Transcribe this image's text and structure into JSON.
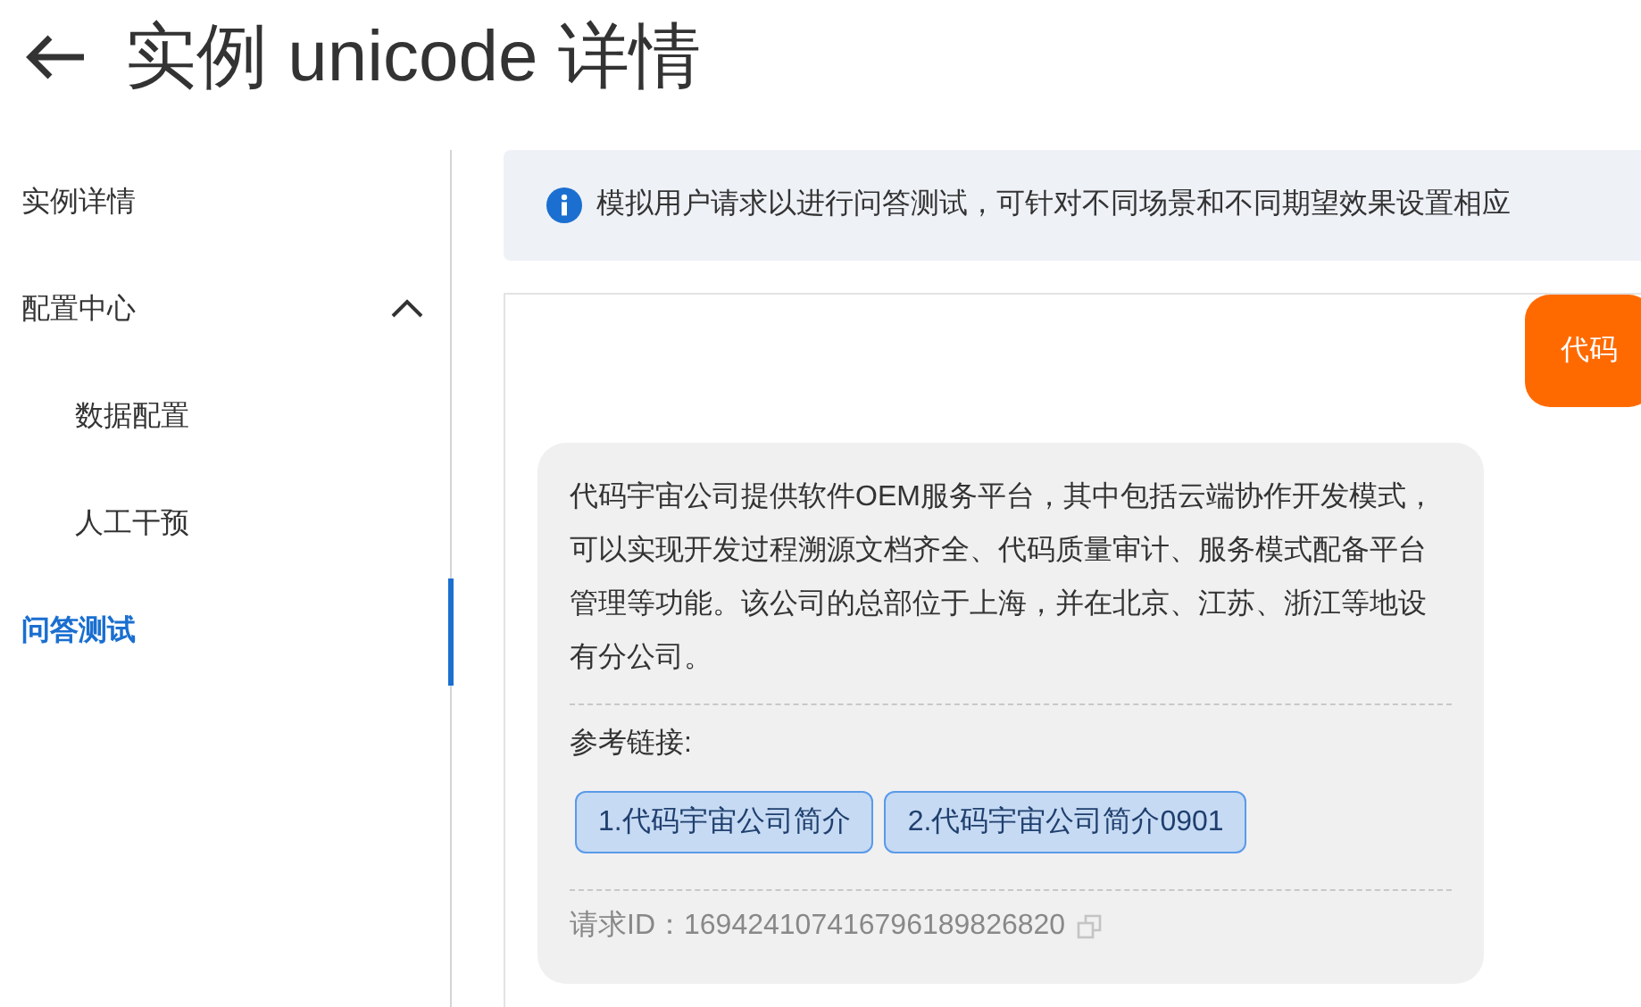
{
  "header": {
    "title": "实例 unicode 详情"
  },
  "sidebar": {
    "items": [
      {
        "label": "实例详情",
        "selected": false
      },
      {
        "label": "配置中心",
        "selected": false,
        "expanded": true,
        "children": [
          {
            "label": "数据配置",
            "selected": false
          },
          {
            "label": "人工干预",
            "selected": false
          }
        ]
      },
      {
        "label": "问答测试",
        "selected": true
      }
    ]
  },
  "info_banner": {
    "text": "模拟用户请求以进行问答测试，可针对不同场景和不同期望效果设置相应"
  },
  "chat": {
    "messages": [
      {
        "kind": "user",
        "text": "代码"
      },
      {
        "kind": "answer",
        "text": "代码宇宙公司提供软件OEM服务平台，其中包括云端协作开发模式，可以实现开发过程溯源文档齐全、代码质量审计、服务模式配备平台管理等功能。该公司的总部位于上海，并在北京、江苏、浙江等地设有分公司。",
        "references_label": "参考链接:",
        "references": [
          "1.代码宇宙公司简介",
          "2.代码宇宙公司简介0901"
        ],
        "request_id": "请求ID：169424107416796189826820"
      }
    ]
  }
}
